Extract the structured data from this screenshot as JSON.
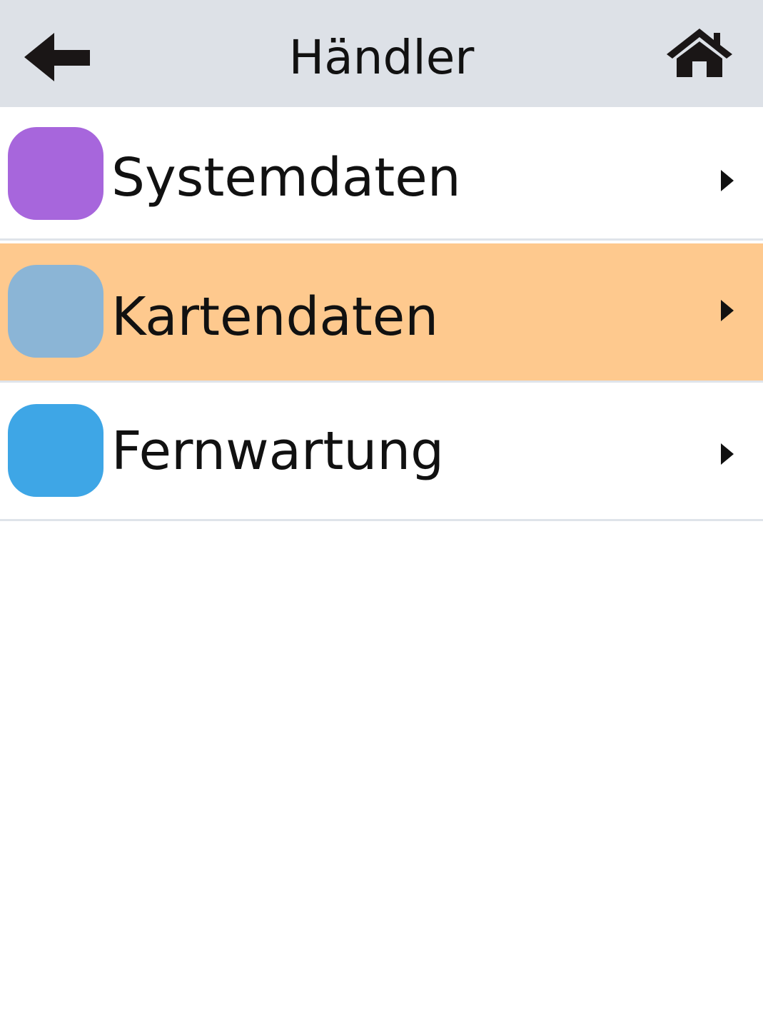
{
  "header": {
    "title": "Händler",
    "back_icon": "arrow-left-icon",
    "home_icon": "home-icon",
    "background": "#dde1e7"
  },
  "menu": {
    "items": [
      {
        "label": "Systemdaten",
        "swatch_color": "#a766dc",
        "highlighted": false,
        "icon": "chevron-right-icon"
      },
      {
        "label": "Kartendaten",
        "swatch_color": "#8bb5d6",
        "highlighted": true,
        "icon": "chevron-right-icon"
      },
      {
        "label": "Fernwartung",
        "swatch_color": "#3ea6e6",
        "highlighted": false,
        "icon": "chevron-right-icon"
      }
    ],
    "highlight_color": "#fec98e"
  }
}
